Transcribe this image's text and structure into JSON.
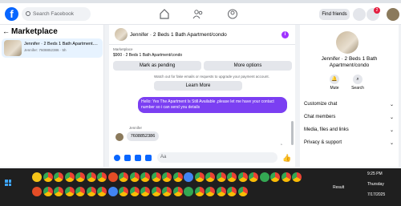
{
  "topnav": {
    "search_placeholder": "Search Facebook",
    "find_friends": "Find friends",
    "notification_count": "2"
  },
  "left": {
    "title": "Marketplace",
    "conversation": {
      "name": "Jennifer · 2 Beds 1 Bath Apartment....",
      "sub": "Jennifer: 7608852386 · 5h"
    }
  },
  "chat": {
    "title": "Jennifer · 2 Beds 1 Bath Apartment/condo",
    "marketplace_label": "Marketplace",
    "listing": "$900 · 2 Beds 1 Bath Apartment/condo",
    "mark_pending": "Mark as pending",
    "more_options": "More options",
    "notice": "Watch out for fake emails or requests to upgrade your payment account.",
    "learn_more": "Learn More",
    "my_message": "Hello: Yes The Apartment Is Still Available ,please let me have your contact number so i can send you details",
    "sender_name": "Jennifer",
    "their_message": "7608852386",
    "composer_placeholder": "Aa"
  },
  "right": {
    "name": "Jennifer · 2 Beds 1 Bath Apartment/condo",
    "mute": "Mute",
    "search": "Search",
    "sections": [
      "Customize chat",
      "Chat members",
      "Media, files and links",
      "Privacy & support"
    ]
  },
  "taskbar": {
    "weather": "Result",
    "time": "9:25 PM",
    "day": "Thursday",
    "date": "7/17/2025"
  }
}
